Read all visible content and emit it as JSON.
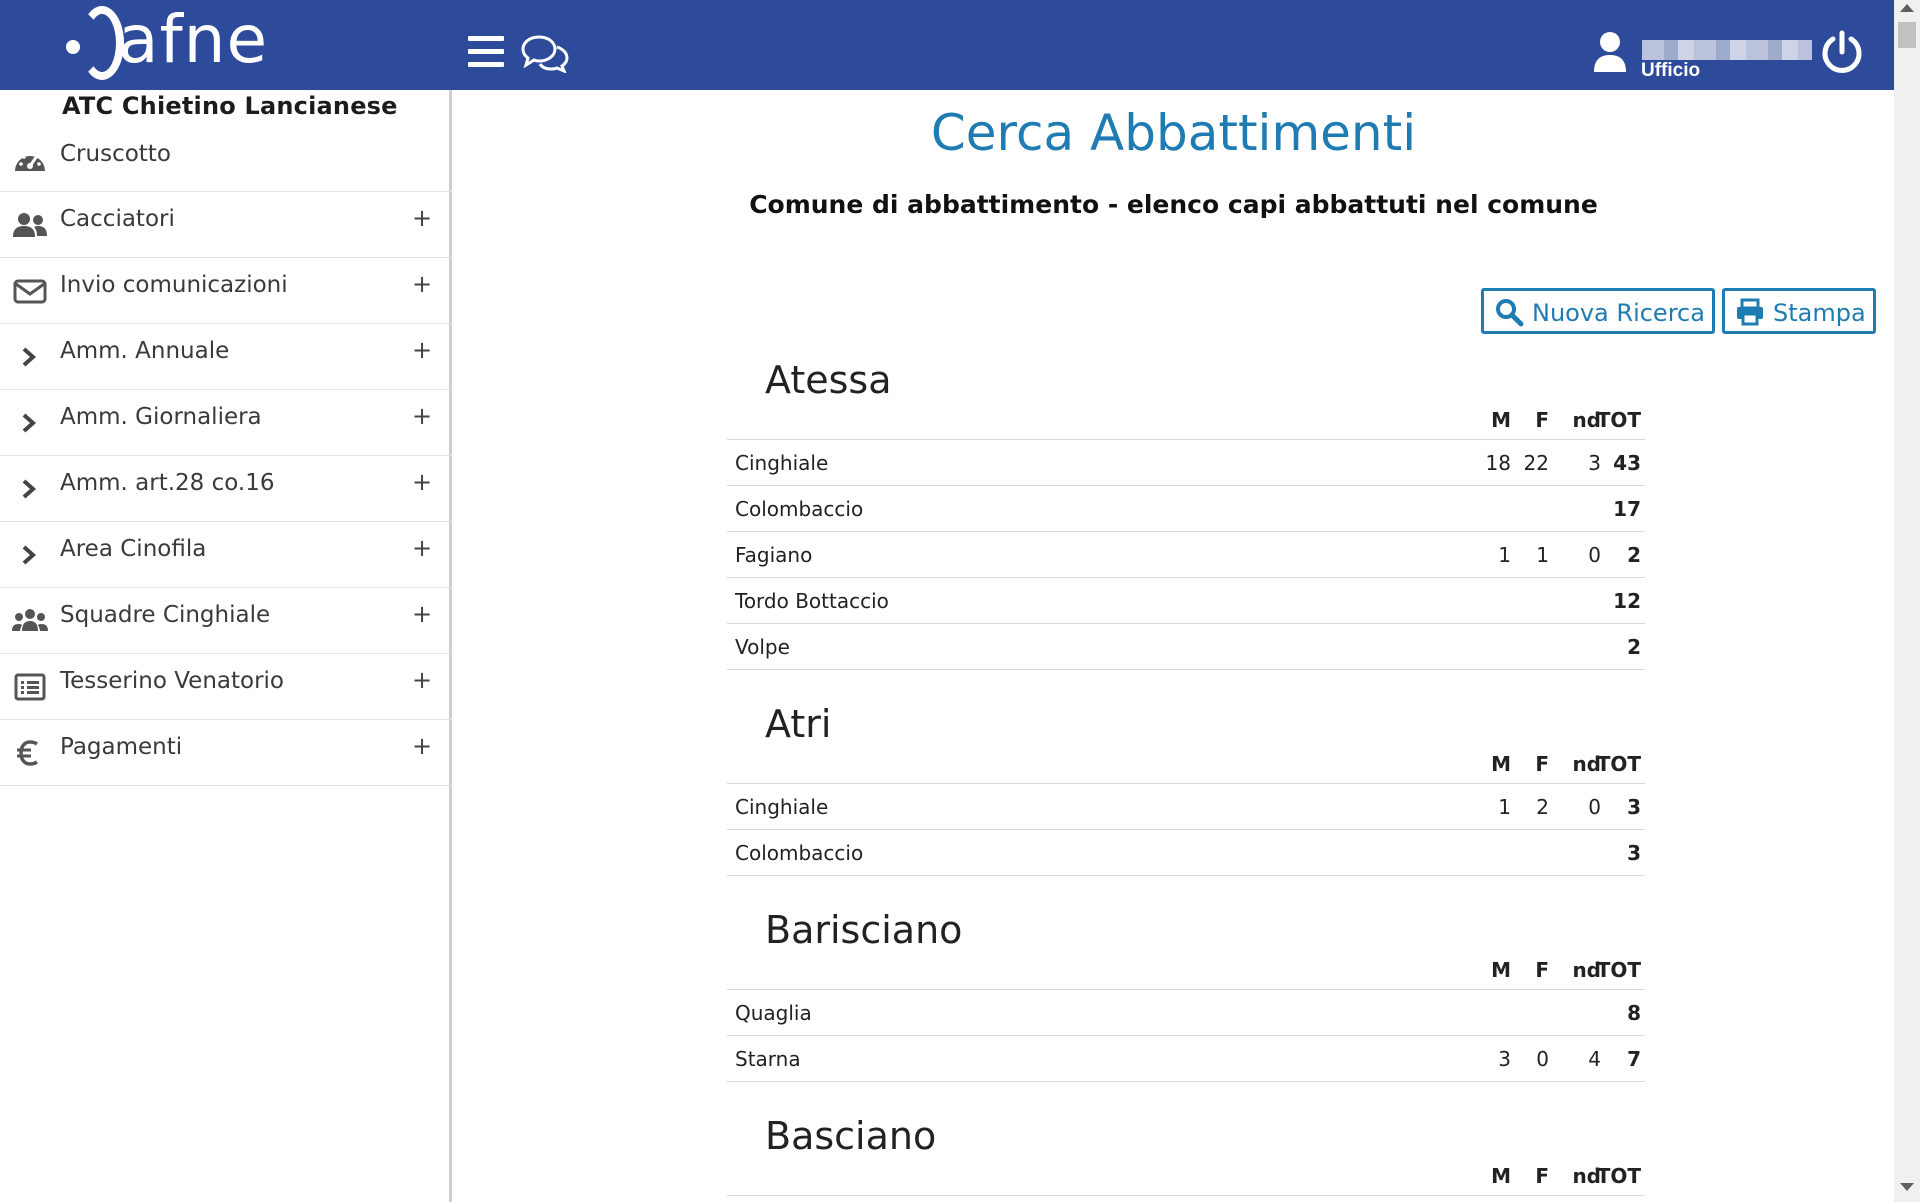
{
  "header": {
    "logo_text": "afne",
    "user_role": "Ufficio"
  },
  "sidebar": {
    "org_title": "ATC Chietino Lancianese",
    "items": [
      {
        "label": "Cruscotto",
        "icon": "dashboard-gauge-icon",
        "expandable": false
      },
      {
        "label": "Cacciatori",
        "icon": "users-icon",
        "expandable": true
      },
      {
        "label": "Invio comunicazioni",
        "icon": "envelope-icon",
        "expandable": true
      },
      {
        "label": "Amm. Annuale",
        "icon": "chevron-right-icon",
        "expandable": true
      },
      {
        "label": "Amm. Giornaliera",
        "icon": "chevron-right-icon",
        "expandable": true
      },
      {
        "label": "Amm. art.28 co.16",
        "icon": "chevron-right-icon",
        "expandable": true
      },
      {
        "label": "Area Cinofila",
        "icon": "chevron-right-icon",
        "expandable": true
      },
      {
        "label": "Squadre Cinghiale",
        "icon": "group-icon",
        "expandable": true
      },
      {
        "label": "Tesserino Venatorio",
        "icon": "list-icon",
        "expandable": true
      },
      {
        "label": "Pagamenti",
        "icon": "euro-icon",
        "expandable": true
      }
    ],
    "plus_symbol": "+"
  },
  "main": {
    "title": "Cerca Abbattimenti",
    "subtitle": "Comune di abbattimento - elenco capi abbattuti nel comune",
    "buttons": {
      "new_search": "Nuova Ricerca",
      "print": "Stampa"
    },
    "columns": {
      "m": "M",
      "f": "F",
      "nd": "nd",
      "tot": "TOT"
    },
    "groups": [
      {
        "name": "Atessa",
        "rows": [
          {
            "species": "Cinghiale",
            "m": "18",
            "f": "22",
            "nd": "3",
            "tot": "43"
          },
          {
            "species": "Colombaccio",
            "m": "",
            "f": "",
            "nd": "",
            "tot": "17"
          },
          {
            "species": "Fagiano",
            "m": "1",
            "f": "1",
            "nd": "0",
            "tot": "2"
          },
          {
            "species": "Tordo Bottaccio",
            "m": "",
            "f": "",
            "nd": "",
            "tot": "12"
          },
          {
            "species": "Volpe",
            "m": "",
            "f": "",
            "nd": "",
            "tot": "2"
          }
        ]
      },
      {
        "name": "Atri",
        "rows": [
          {
            "species": "Cinghiale",
            "m": "1",
            "f": "2",
            "nd": "0",
            "tot": "3"
          },
          {
            "species": "Colombaccio",
            "m": "",
            "f": "",
            "nd": "",
            "tot": "3"
          }
        ]
      },
      {
        "name": "Barisciano",
        "rows": [
          {
            "species": "Quaglia",
            "m": "",
            "f": "",
            "nd": "",
            "tot": "8"
          },
          {
            "species": "Starna",
            "m": "3",
            "f": "0",
            "nd": "4",
            "tot": "7"
          }
        ]
      },
      {
        "name": "Basciano",
        "rows": []
      }
    ]
  },
  "colors": {
    "header_bg": "#2e4b9b",
    "accent": "#1f7cb2"
  }
}
